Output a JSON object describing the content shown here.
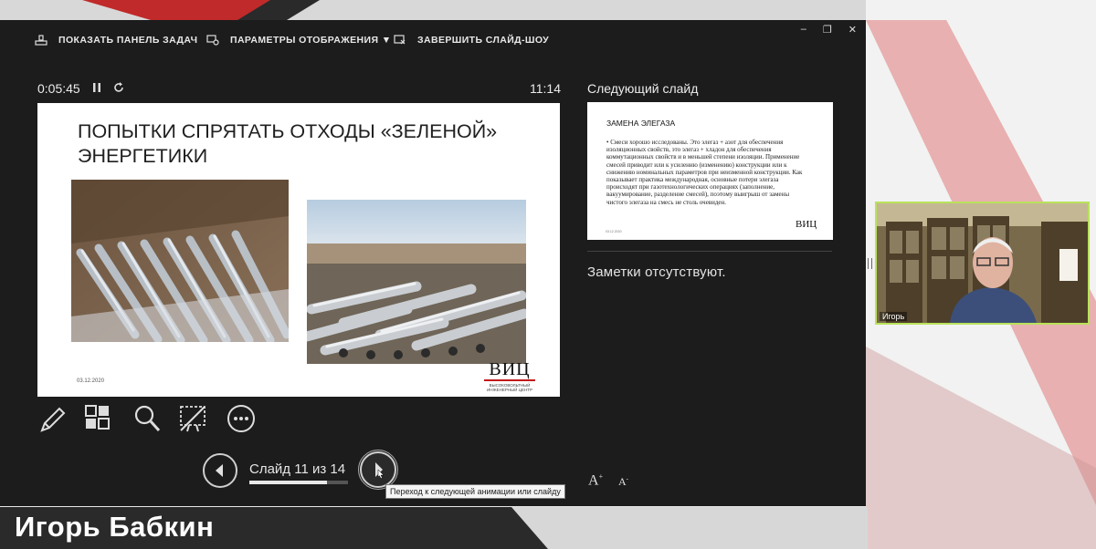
{
  "toolbar": {
    "show_taskbar": "ПОКАЗАТЬ ПАНЕЛЬ ЗАДАЧ",
    "display_settings": "ПАРАМЕТРЫ ОТОБРАЖЕНИЯ ▼",
    "end_show": "ЗАВЕРШИТЬ СЛАЙД-ШОУ"
  },
  "window_controls": {
    "minimize": "–",
    "restore": "❐",
    "close": "✕"
  },
  "timer": "0:05:45",
  "clock": "11:14",
  "current_slide": {
    "title": "ПОПЫТКИ СПРЯТАТЬ ОТХОДЫ «ЗЕЛЕНОЙ» ЭНЕРГЕТИКИ",
    "date": "03.12.2020",
    "logo_text": "ВИЦ",
    "logo_subtitle": "ВЫСОКОВОЛЬТНЫЙ ИНЖЕНЕРНЫЙ ЦЕНТР"
  },
  "navigation": {
    "slide_counter": "Слайд 11 из 14",
    "progress_fraction": 0.786,
    "tooltip": "Переход к следующей анимации или слайду"
  },
  "next_slide": {
    "label": "Следующий слайд",
    "title": "ЗАМЕНА ЭЛЕГАЗА",
    "body": "• Смеси хорошо исследованы. Это элегаз + азот для обеспечения изоляционных свойств, это элегаз + хладон для обеспечения коммутационных свойств и в меньшей степени изоляции. Применение смесей приводит или к усилению (изменению) конструкции или к снижению номинальных параметров при неизменной конструкции. Как показывает практика международная, основные потери элегаза происходят при газотехнологических операциях (заполнение, вакуумирование, разделение смесей), поэтому выигрыш от замены чистого элегаза на смесь не столь очевиден.",
    "date": "03.12.2020",
    "logo_text": "ВИЦ"
  },
  "notes": "Заметки отсутствуют.",
  "font_controls": {
    "increase": "A",
    "decrease": "A"
  },
  "participant": {
    "name": "Игорь"
  },
  "speaker_name": "Игорь Бабкин",
  "colors": {
    "presenter_bg": "#1c1c1c",
    "video_border": "#b9e25a",
    "accent_red": "#c21a1a"
  }
}
